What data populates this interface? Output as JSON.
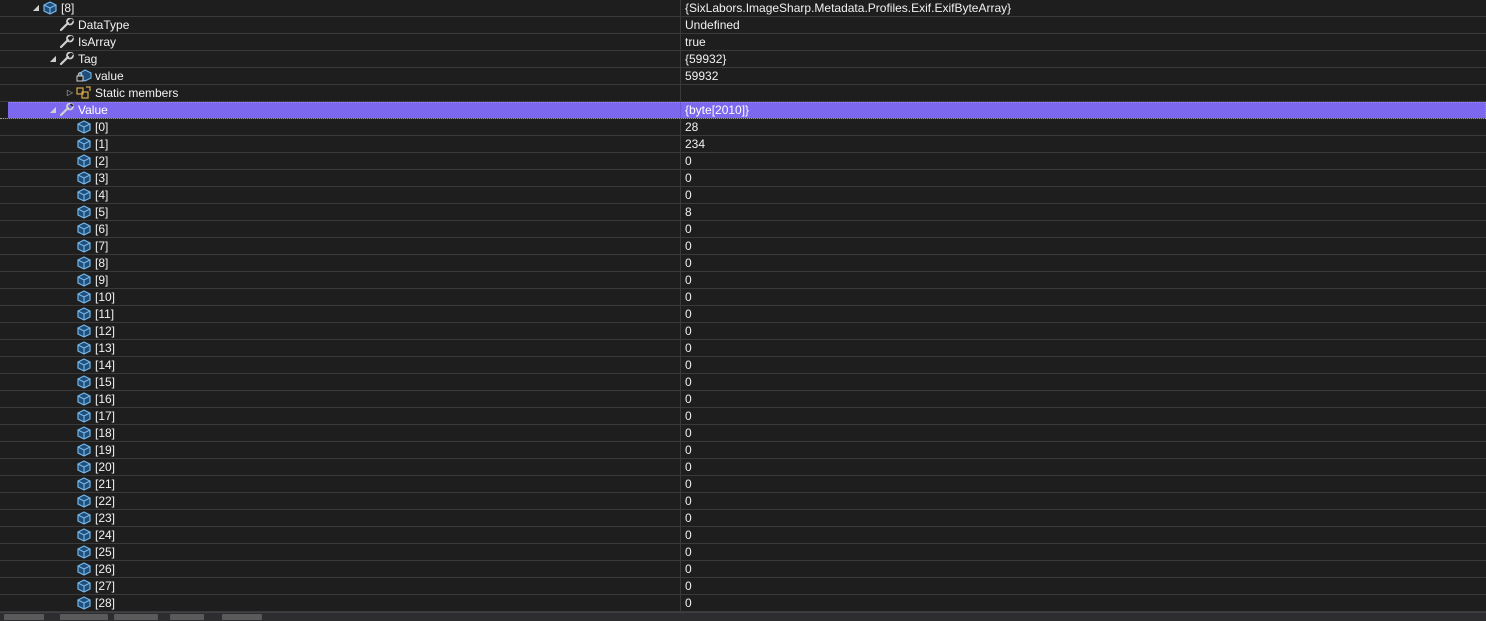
{
  "watch": {
    "rows": [
      {
        "name": "[8]",
        "value": "{SixLabors.ImageSharp.Metadata.Profiles.Exif.ExifByteArray}",
        "icon": "object-icon",
        "depth": 0,
        "expander": "expanded"
      },
      {
        "name": "DataType",
        "value": "Undefined",
        "icon": "wrench-icon",
        "depth": 1,
        "expander": "none"
      },
      {
        "name": "IsArray",
        "value": "true",
        "icon": "wrench-icon",
        "depth": 1,
        "expander": "none"
      },
      {
        "name": "Tag",
        "value": "{59932}",
        "icon": "wrench-icon",
        "depth": 1,
        "expander": "expanded"
      },
      {
        "name": "value",
        "value": "59932",
        "icon": "locked-field-icon",
        "depth": 2,
        "expander": "none"
      },
      {
        "name": "Static members",
        "value": "",
        "icon": "static-members-icon",
        "depth": 2,
        "expander": "collapsed"
      },
      {
        "name": "Value",
        "value": "{byte[2010]}",
        "icon": "wrench-icon",
        "depth": 1,
        "expander": "expanded",
        "selected": true
      },
      {
        "name": "[0]",
        "value": "28",
        "icon": "array-element-icon",
        "depth": 2,
        "expander": "none"
      },
      {
        "name": "[1]",
        "value": "234",
        "icon": "array-element-icon",
        "depth": 2,
        "expander": "none"
      },
      {
        "name": "[2]",
        "value": "0",
        "icon": "array-element-icon",
        "depth": 2,
        "expander": "none"
      },
      {
        "name": "[3]",
        "value": "0",
        "icon": "array-element-icon",
        "depth": 2,
        "expander": "none"
      },
      {
        "name": "[4]",
        "value": "0",
        "icon": "array-element-icon",
        "depth": 2,
        "expander": "none"
      },
      {
        "name": "[5]",
        "value": "8",
        "icon": "array-element-icon",
        "depth": 2,
        "expander": "none"
      },
      {
        "name": "[6]",
        "value": "0",
        "icon": "array-element-icon",
        "depth": 2,
        "expander": "none"
      },
      {
        "name": "[7]",
        "value": "0",
        "icon": "array-element-icon",
        "depth": 2,
        "expander": "none"
      },
      {
        "name": "[8]",
        "value": "0",
        "icon": "array-element-icon",
        "depth": 2,
        "expander": "none"
      },
      {
        "name": "[9]",
        "value": "0",
        "icon": "array-element-icon",
        "depth": 2,
        "expander": "none"
      },
      {
        "name": "[10]",
        "value": "0",
        "icon": "array-element-icon",
        "depth": 2,
        "expander": "none"
      },
      {
        "name": "[11]",
        "value": "0",
        "icon": "array-element-icon",
        "depth": 2,
        "expander": "none"
      },
      {
        "name": "[12]",
        "value": "0",
        "icon": "array-element-icon",
        "depth": 2,
        "expander": "none"
      },
      {
        "name": "[13]",
        "value": "0",
        "icon": "array-element-icon",
        "depth": 2,
        "expander": "none"
      },
      {
        "name": "[14]",
        "value": "0",
        "icon": "array-element-icon",
        "depth": 2,
        "expander": "none"
      },
      {
        "name": "[15]",
        "value": "0",
        "icon": "array-element-icon",
        "depth": 2,
        "expander": "none"
      },
      {
        "name": "[16]",
        "value": "0",
        "icon": "array-element-icon",
        "depth": 2,
        "expander": "none"
      },
      {
        "name": "[17]",
        "value": "0",
        "icon": "array-element-icon",
        "depth": 2,
        "expander": "none"
      },
      {
        "name": "[18]",
        "value": "0",
        "icon": "array-element-icon",
        "depth": 2,
        "expander": "none"
      },
      {
        "name": "[19]",
        "value": "0",
        "icon": "array-element-icon",
        "depth": 2,
        "expander": "none"
      },
      {
        "name": "[20]",
        "value": "0",
        "icon": "array-element-icon",
        "depth": 2,
        "expander": "none"
      },
      {
        "name": "[21]",
        "value": "0",
        "icon": "array-element-icon",
        "depth": 2,
        "expander": "none"
      },
      {
        "name": "[22]",
        "value": "0",
        "icon": "array-element-icon",
        "depth": 2,
        "expander": "none"
      },
      {
        "name": "[23]",
        "value": "0",
        "icon": "array-element-icon",
        "depth": 2,
        "expander": "none"
      },
      {
        "name": "[24]",
        "value": "0",
        "icon": "array-element-icon",
        "depth": 2,
        "expander": "none"
      },
      {
        "name": "[25]",
        "value": "0",
        "icon": "array-element-icon",
        "depth": 2,
        "expander": "none"
      },
      {
        "name": "[26]",
        "value": "0",
        "icon": "array-element-icon",
        "depth": 2,
        "expander": "none"
      },
      {
        "name": "[27]",
        "value": "0",
        "icon": "array-element-icon",
        "depth": 2,
        "expander": "none"
      },
      {
        "name": "[28]",
        "value": "0",
        "icon": "array-element-icon",
        "depth": 2,
        "expander": "none"
      }
    ]
  },
  "colors": {
    "background": "#1e1e1e",
    "selection": "#7b68ee",
    "gridline": "#3a3a3a",
    "text": "#f1f1f1"
  }
}
